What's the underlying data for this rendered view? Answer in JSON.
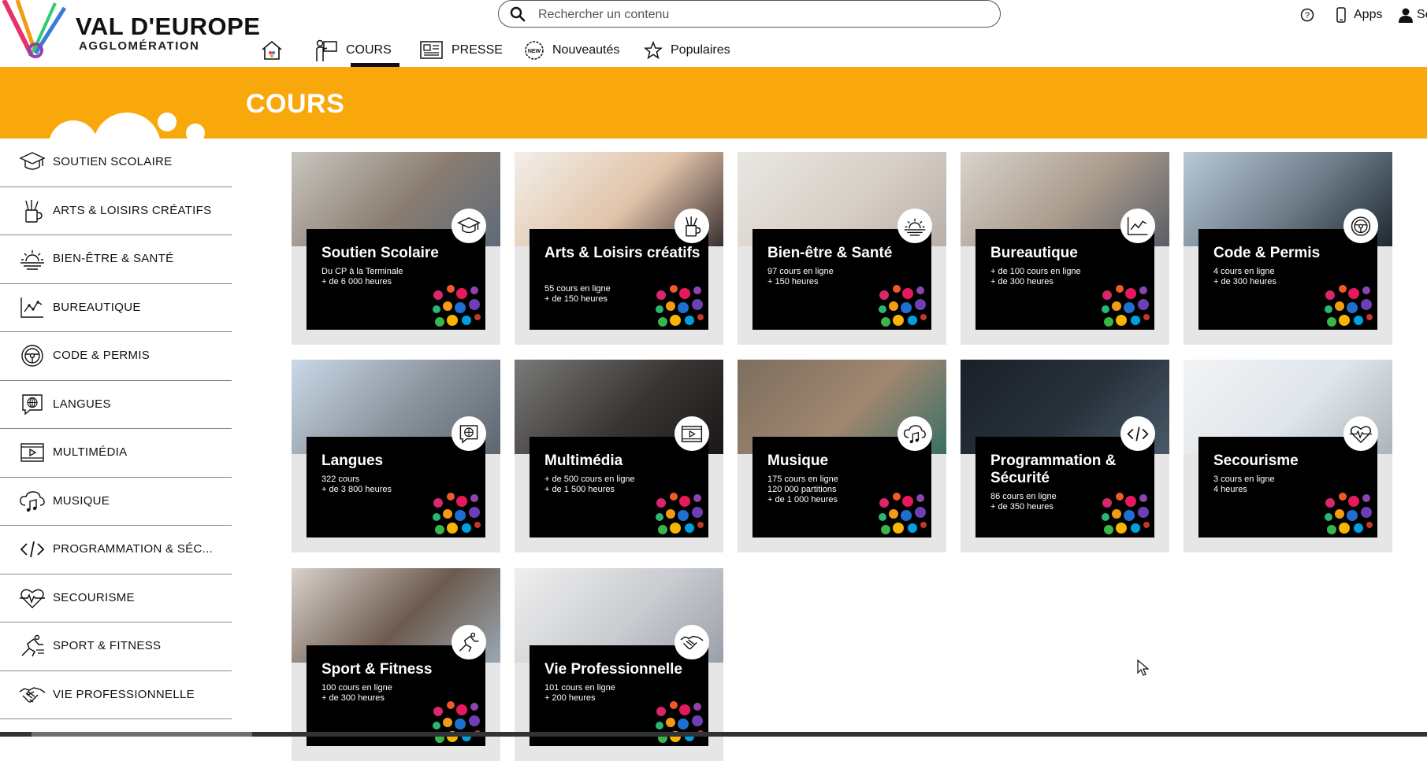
{
  "logo": {
    "line1": "VAL D'EUROPE",
    "line2": "AGGLOMÉRATION"
  },
  "search": {
    "placeholder": "Rechercher un contenu"
  },
  "top_util": {
    "help_icon": "question-circle-icon",
    "apps_label": "Apps",
    "account_label": "Se"
  },
  "nav": [
    {
      "id": "home",
      "label": "",
      "icon": "home-icon"
    },
    {
      "id": "cours",
      "label": "COURS",
      "icon": "teacher-icon",
      "active": true
    },
    {
      "id": "presse",
      "label": "PRESSE",
      "icon": "newspaper-icon"
    },
    {
      "id": "nouveautes",
      "label": "Nouveautés",
      "icon": "new-badge-icon"
    },
    {
      "id": "populaires",
      "label": "Populaires",
      "icon": "star-icon"
    }
  ],
  "banner": {
    "title": "COURS",
    "color": "#f9a80c"
  },
  "sidebar": {
    "items": [
      {
        "label": "SOUTIEN SCOLAIRE",
        "icon": "graduation-cap-icon"
      },
      {
        "label": "ARTS & LOISIRS CRÉATIFS",
        "icon": "brush-pot-icon"
      },
      {
        "label": "BIEN-ÊTRE & SANTÉ",
        "icon": "sunrise-icon"
      },
      {
        "label": "BUREAUTIQUE",
        "icon": "chart-icon"
      },
      {
        "label": "CODE & PERMIS",
        "icon": "steering-wheel-icon"
      },
      {
        "label": "LANGUES",
        "icon": "globe-chat-icon"
      },
      {
        "label": "MULTIMÉDIA",
        "icon": "video-play-icon"
      },
      {
        "label": "MUSIQUE",
        "icon": "cloud-music-icon"
      },
      {
        "label": "PROGRAMMATION & SÉC...",
        "icon": "code-icon"
      },
      {
        "label": "SECOURISME",
        "icon": "heart-pulse-icon"
      },
      {
        "label": "SPORT & FITNESS",
        "icon": "running-icon"
      },
      {
        "label": "VIE PROFESSIONNELLE",
        "icon": "handshake-icon"
      }
    ]
  },
  "cards": [
    {
      "title": "Soutien Scolaire",
      "lines": [
        "Du CP à la Terminale",
        "+ de 6 000 heures"
      ],
      "icon": "graduation-cap-icon"
    },
    {
      "title": "Arts & Loisirs créatifs",
      "lines": [
        "55 cours en ligne",
        "+ de 150 heures"
      ],
      "icon": "brush-pot-icon"
    },
    {
      "title": "Bien-être & Santé",
      "lines": [
        "97 cours en ligne",
        "+ 150 heures"
      ],
      "icon": "sunrise-icon"
    },
    {
      "title": "Bureautique",
      "lines": [
        "+ de 100 cours en ligne",
        "+ de 300 heures"
      ],
      "icon": "chart-icon"
    },
    {
      "title": "Code & Permis",
      "lines": [
        "4 cours en ligne",
        "+ de 300 heures"
      ],
      "icon": "steering-wheel-icon"
    },
    {
      "title": "Langues",
      "lines": [
        "322 cours",
        "+ de 3 800 heures"
      ],
      "icon": "globe-chat-icon"
    },
    {
      "title": "Multimédia",
      "lines": [
        "+ de 500 cours en ligne",
        "+ de 1 500 heures"
      ],
      "icon": "video-play-icon"
    },
    {
      "title": "Musique",
      "lines": [
        "175 cours en ligne",
        "120 000 partitions",
        "+ de 1 000 heures"
      ],
      "icon": "cloud-music-icon"
    },
    {
      "title": "Programmation & Sécurité",
      "lines": [
        "86 cours en ligne",
        "+ de 350 heures"
      ],
      "icon": "code-icon"
    },
    {
      "title": "Secourisme",
      "lines": [
        "3 cours en ligne",
        "4 heures"
      ],
      "icon": "heart-pulse-icon"
    },
    {
      "title": "Sport & Fitness",
      "lines": [
        "100 cours en ligne",
        "+ de 300 heures"
      ],
      "icon": "running-icon"
    },
    {
      "title": "Vie Professionnelle",
      "lines": [
        "101 cours en ligne",
        "+ 200 heures"
      ],
      "icon": "handshake-icon"
    }
  ]
}
